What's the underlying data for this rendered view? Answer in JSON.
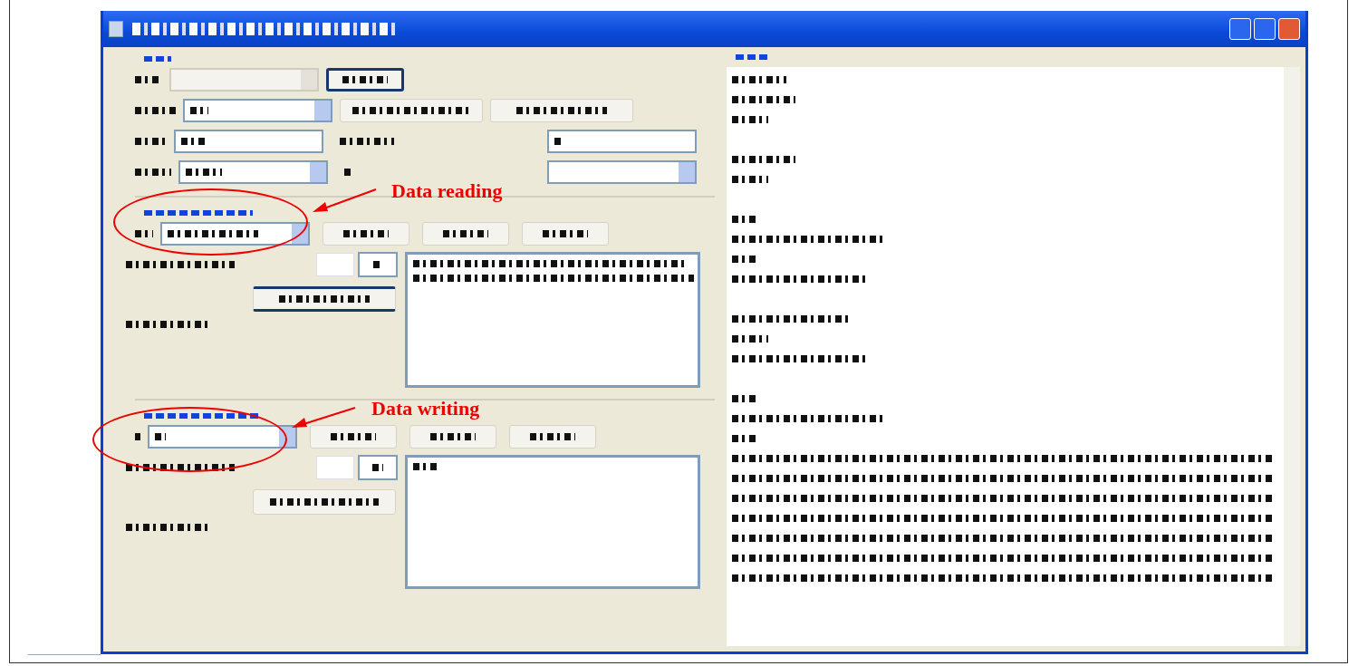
{
  "annotations": [
    {
      "label": "Data reading"
    },
    {
      "label": "Data writing"
    }
  ]
}
